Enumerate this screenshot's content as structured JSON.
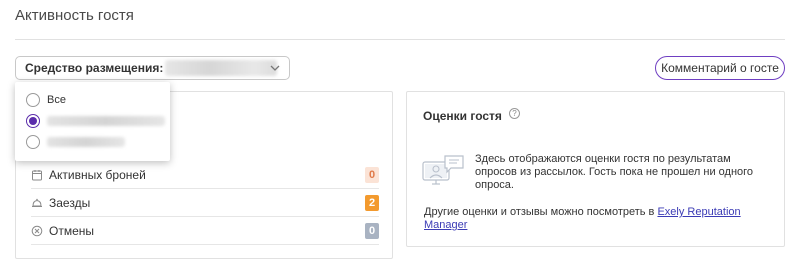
{
  "header": {
    "title": "Активность гостя"
  },
  "property_select": {
    "label": "Средство размещения:",
    "value": "",
    "chevron_icon": "chevron-down-icon"
  },
  "comment_button": {
    "label": "Комментарий о госте",
    "border_color": "#6f3fc2"
  },
  "dropdown": {
    "options": [
      {
        "label": "Все",
        "checked": false
      },
      {
        "label": "",
        "checked": true
      },
      {
        "label": "",
        "checked": false
      }
    ],
    "accent": "#5b2dab"
  },
  "stats": {
    "rows": [
      {
        "icon": "calendar-icon",
        "label": "Активных броней",
        "value": "0",
        "badge_bg": "#fbe3d6",
        "badge_fg": "#e07a4a"
      },
      {
        "icon": "bell-icon",
        "label": "Заезды",
        "value": "2",
        "badge_bg": "#f39a2e",
        "badge_fg": "#ffffff"
      },
      {
        "icon": "cancel-circle-icon",
        "label": "Отмены",
        "value": "0",
        "badge_bg": "#a9b3c2",
        "badge_fg": "#ffffff"
      }
    ]
  },
  "ratings": {
    "title": "Оценки гостя",
    "help_icon": "question-circle-icon",
    "illustration_icon": "feedback-illustration-icon",
    "description": "Здесь отображаются оценки гостя по результатам опросов из рассылок. Гость пока не прошел ни одного опроса.",
    "other_prefix": "Другие оценки и отзывы можно посмотреть в ",
    "other_link": "Exely Reputation Manager"
  }
}
